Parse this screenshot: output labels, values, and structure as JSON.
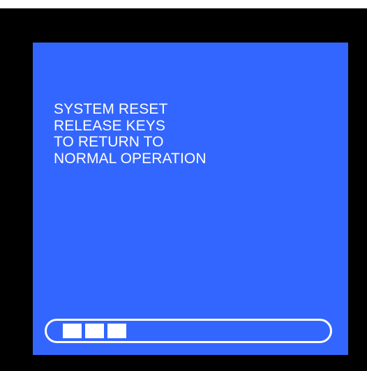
{
  "display": {
    "bezel_color": "#000000",
    "screen_color": "#3366ff",
    "text_color": "#ffffff",
    "message_lines": [
      "SYSTEM RESET",
      "RELEASE KEYS",
      "TO RETURN TO",
      "NORMAL OPERATION"
    ],
    "progress": {
      "filled_segments": 3
    }
  }
}
